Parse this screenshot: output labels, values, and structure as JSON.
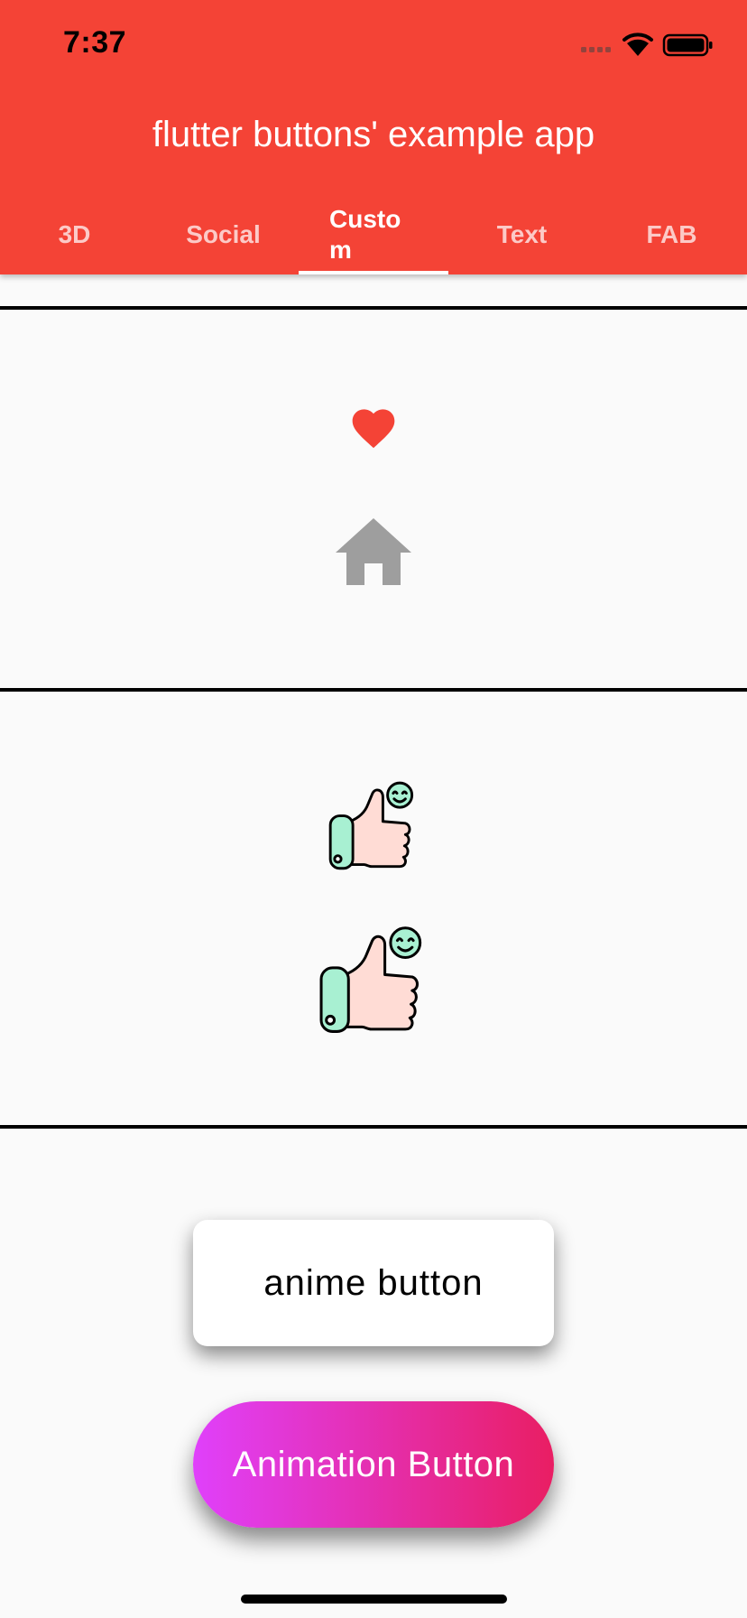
{
  "status_bar": {
    "time": "7:37",
    "icons": [
      "cellular-signal-icon",
      "wifi-icon",
      "battery-icon"
    ]
  },
  "app_bar": {
    "title": "flutter buttons' example app",
    "background": "#f44336",
    "tabs": [
      {
        "label": "3D",
        "active": false
      },
      {
        "label": "Social",
        "active": false
      },
      {
        "label": "Custom",
        "active": true
      },
      {
        "label": "Text",
        "active": false
      },
      {
        "label": "FAB",
        "active": false
      }
    ]
  },
  "content": {
    "section1": {
      "icons": [
        "heart-icon",
        "home-icon"
      ],
      "heart_color": "#f44336",
      "home_color": "#9e9e9e"
    },
    "section2": {
      "icons": [
        "thumbs-up-icon",
        "thumbs-up-icon"
      ]
    },
    "section3": {
      "anime_button_label": "anime button",
      "animation_button_label": "Animation Button",
      "gradient": [
        "#e040fb",
        "#e91e63"
      ]
    }
  }
}
